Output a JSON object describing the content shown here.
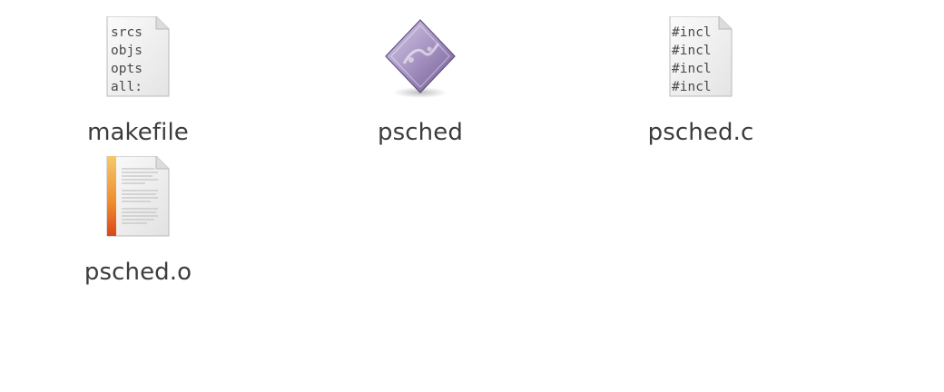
{
  "files": [
    {
      "name": "makefile",
      "icon": "text-file-icon",
      "preview_lines": [
        "srcs",
        "objs",
        "opts",
        "all:"
      ]
    },
    {
      "name": "psched",
      "icon": "executable-icon"
    },
    {
      "name": "psched.c",
      "icon": "c-source-file-icon",
      "preview_lines": [
        "#incl",
        "#incl",
        "#incl",
        "#incl"
      ]
    },
    {
      "name": "psched.o",
      "icon": "object-file-icon"
    }
  ],
  "colors": {
    "label_text": "#3c3c3c",
    "executable_purple": "#8e7aab",
    "object_orange": "#e8651c"
  }
}
